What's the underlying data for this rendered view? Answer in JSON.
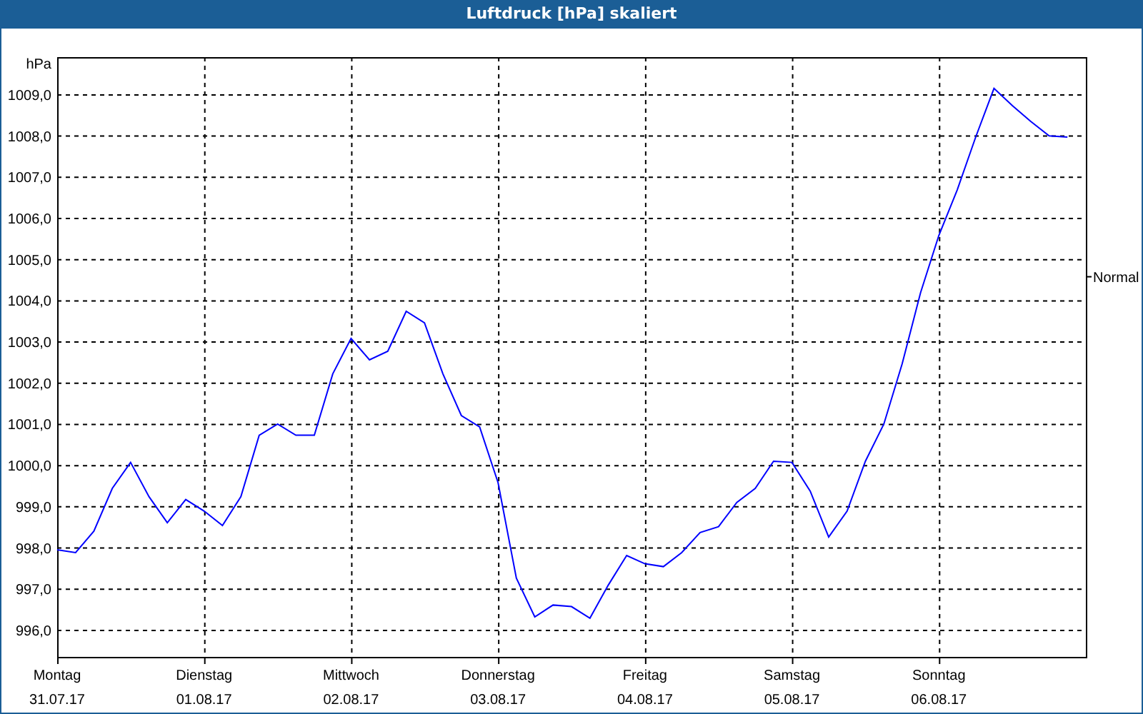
{
  "window": {
    "title": "Luftdruck [hPa] skaliert"
  },
  "chart": {
    "chart_data": {
      "type": "line",
      "ylabel": "hPa",
      "categories": [
        "Montag",
        null,
        null,
        null,
        null,
        null,
        null,
        null,
        "Dienstag",
        null,
        null,
        null,
        null,
        null,
        null,
        null,
        "Mittwoch",
        null,
        null,
        null,
        null,
        null,
        null,
        null,
        "Donnerstag",
        null,
        null,
        null,
        null,
        null,
        null,
        null,
        "Freitag",
        null,
        null,
        null,
        null,
        null,
        null,
        null,
        "Samstag",
        null,
        null,
        null,
        null,
        null,
        null,
        null,
        "Sonntag",
        null,
        null,
        null,
        null,
        null,
        null,
        null
      ],
      "series": [
        {
          "color": "#0000ff",
          "values": [
            997.94,
            997.87,
            998.39,
            999.43,
            1000.06,
            999.23,
            998.6,
            999.16,
            998.88,
            998.53,
            999.23,
            1000.72,
            1000.99,
            1000.72,
            1000.72,
            1002.21,
            1003.07,
            1002.55,
            1002.76,
            1003.73,
            1003.45,
            1002.21,
            1001.2,
            1000.92,
            999.57,
            997.25,
            996.31,
            996.6,
            996.56,
            996.28,
            997.08,
            997.8,
            997.6,
            997.53,
            997.87,
            998.36,
            998.5,
            999.09,
            999.43,
            1000.09,
            1000.06,
            999.36,
            998.25,
            998.88,
            1000.09,
            1000.99,
            1002.45,
            1004.18,
            1005.57,
            1006.68,
            1007.96,
            1009.14,
            1008.72,
            1008.34,
            1007.99,
            1007.96
          ]
        }
      ],
      "ylim": [
        995.34,
        1009.9
      ],
      "grid": true,
      "yticks": [
        {
          "value": 996,
          "label": "996,0"
        },
        {
          "value": 997,
          "label": "997,0"
        },
        {
          "value": 998,
          "label": "998,0"
        },
        {
          "value": 999,
          "label": "999,0"
        },
        {
          "value": 1000,
          "label": "1000,0"
        },
        {
          "value": 1001,
          "label": "1001,0"
        },
        {
          "value": 1002,
          "label": "1002,0"
        },
        {
          "value": 1003,
          "label": "1003,0"
        },
        {
          "value": 1004,
          "label": "1004,0"
        },
        {
          "value": 1005,
          "label": "1005,0"
        },
        {
          "value": 1006,
          "label": "1006,0"
        },
        {
          "value": 1007,
          "label": "1007,0"
        },
        {
          "value": 1008,
          "label": "1008,0"
        },
        {
          "value": 1009,
          "label": "1009,0"
        }
      ],
      "annotations": [
        "Normal"
      ]
    },
    "x_dates": [
      "31.07.17",
      "01.08.17",
      "02.08.17",
      "03.08.17",
      "04.08.17",
      "05.08.17",
      "06.08.17"
    ]
  }
}
